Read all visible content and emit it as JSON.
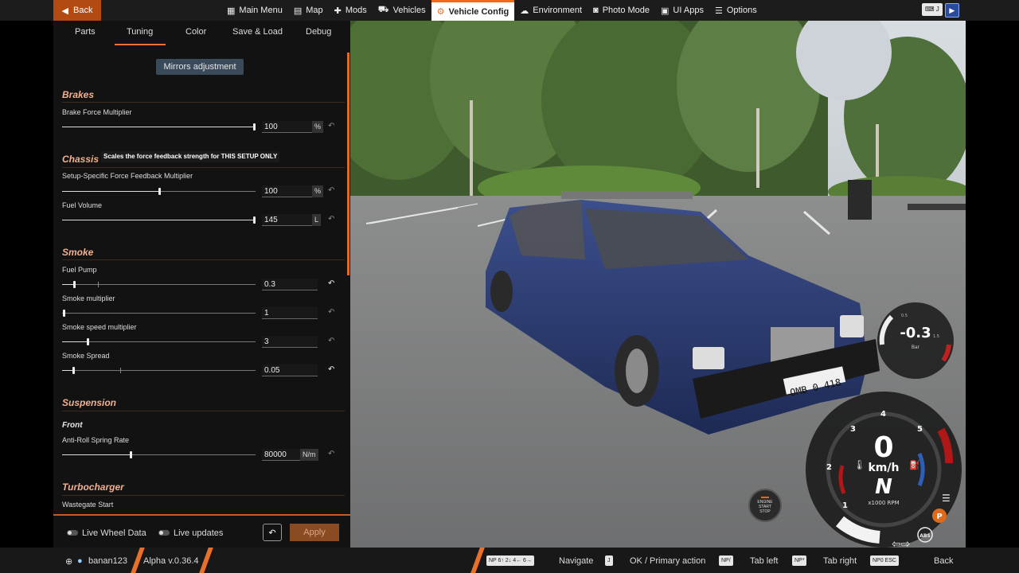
{
  "topbar": {
    "back_label": "Back",
    "menu": [
      {
        "icon": "grid-icon",
        "glyph": "▦",
        "label": "Main Menu"
      },
      {
        "icon": "map-icon",
        "glyph": "▤",
        "label": "Map"
      },
      {
        "icon": "puzzle-icon",
        "glyph": "✚",
        "label": "Mods"
      },
      {
        "icon": "car-icon",
        "glyph": "⛟",
        "label": "Vehicles"
      },
      {
        "icon": "car-config-icon",
        "glyph": "⚙",
        "label": "Vehicle Config"
      },
      {
        "icon": "cloud-sun-icon",
        "glyph": "☁",
        "label": "Environment"
      },
      {
        "icon": "camera-icon",
        "glyph": "◙",
        "label": "Photo Mode"
      },
      {
        "icon": "ui-apps-icon",
        "glyph": "▣",
        "label": "UI Apps"
      },
      {
        "icon": "sliders-icon",
        "glyph": "☰",
        "label": "Options"
      }
    ],
    "shortcut_key": "J"
  },
  "panel": {
    "tabs": [
      "Parts",
      "Tuning",
      "Color",
      "Save & Load",
      "Debug"
    ],
    "mirrors_button": "Mirrors adjustment",
    "tooltip": "Scales the force feedback strength for THIS SETUP ONLY",
    "sections": {
      "brakes": "Brakes",
      "chassis": "Chassis",
      "smoke": "Smoke",
      "suspension": "Suspension",
      "suspension_front": "Front",
      "turbocharger": "Turbocharger"
    },
    "params": {
      "brake_force": {
        "label": "Brake Force Multiplier",
        "value": "100",
        "unit": "%"
      },
      "ffb_mult": {
        "label": "Setup-Specific Force Feedback Multiplier",
        "value": "100",
        "unit": "%"
      },
      "fuel_volume": {
        "label": "Fuel Volume",
        "value": "145",
        "unit": "L"
      },
      "fuel_pump": {
        "label": "Fuel Pump",
        "value": "0.3"
      },
      "smoke_mult": {
        "label": "Smoke multiplier",
        "value": "1"
      },
      "smoke_speed": {
        "label": "Smoke speed multiplier",
        "value": "3"
      },
      "smoke_spread": {
        "label": "Smoke Spread",
        "value": "0.05"
      },
      "arb_rate": {
        "label": "Anti-Roll Spring Rate",
        "value": "80000",
        "unit": "N/m"
      },
      "wastegate": {
        "label": "Wastegate Start"
      }
    },
    "live_wheel_data": "Live Wheel Data",
    "live_updates": "Live updates",
    "apply_label": "Apply"
  },
  "gauges": {
    "boost_value": "-0.3",
    "boost_unit": "Bar",
    "boost_ticks": [
      "0.5",
      "1.5"
    ],
    "speed_value": "0",
    "speed_unit": "km/h",
    "gear": "N",
    "rpm_label": "x1000 RPM",
    "rpm_ticks": [
      "1",
      "2",
      "3",
      "4",
      "5"
    ],
    "abs_label": "ABS",
    "p_label": "P",
    "engine_btn": "ENGINE\nSTART\nSTOP",
    "plate": "OMB 0 418"
  },
  "footer": {
    "user": "banan123",
    "version": "Alpha v.0.36.4",
    "hints": [
      {
        "keys": "NP 6↑ 2↓ 4← 6→",
        "label": "Navigate"
      },
      {
        "keys": "J",
        "label": "OK / Primary action"
      },
      {
        "keys": "NP/",
        "label": "Tab left"
      },
      {
        "keys": "NP*",
        "label": "Tab right"
      },
      {
        "keys": "NP0  ESC",
        "label": "Back"
      }
    ]
  }
}
